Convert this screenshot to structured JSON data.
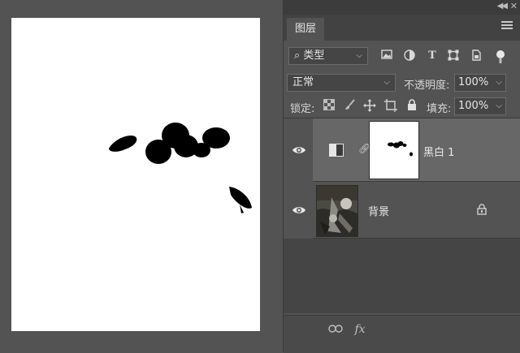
{
  "panel": {
    "tab_label": "图层",
    "filter": {
      "kind_label": "类型",
      "icons": [
        "image-filter-icon",
        "adjustment-filter-icon",
        "type-filter-icon",
        "shape-filter-icon",
        "smart-object-filter-icon",
        "filter-toggle-icon"
      ]
    },
    "blend_mode": "正常",
    "opacity_label": "不透明度:",
    "opacity_value": "100%",
    "lock_label": "锁定:",
    "fill_label": "填充:",
    "fill_value": "100%"
  },
  "layers": [
    {
      "name": "黑白 1",
      "type": "adjustment",
      "visible": true,
      "selected": true
    },
    {
      "name": "背景",
      "type": "background",
      "visible": true,
      "locked": true
    }
  ],
  "footer": {
    "icons": [
      "link-layers-icon",
      "fx-icon"
    ],
    "fx_label": "fx"
  },
  "colors": {
    "panel_bg": "#535353",
    "selected_layer": "#676767",
    "canvas": "#ffffff"
  }
}
